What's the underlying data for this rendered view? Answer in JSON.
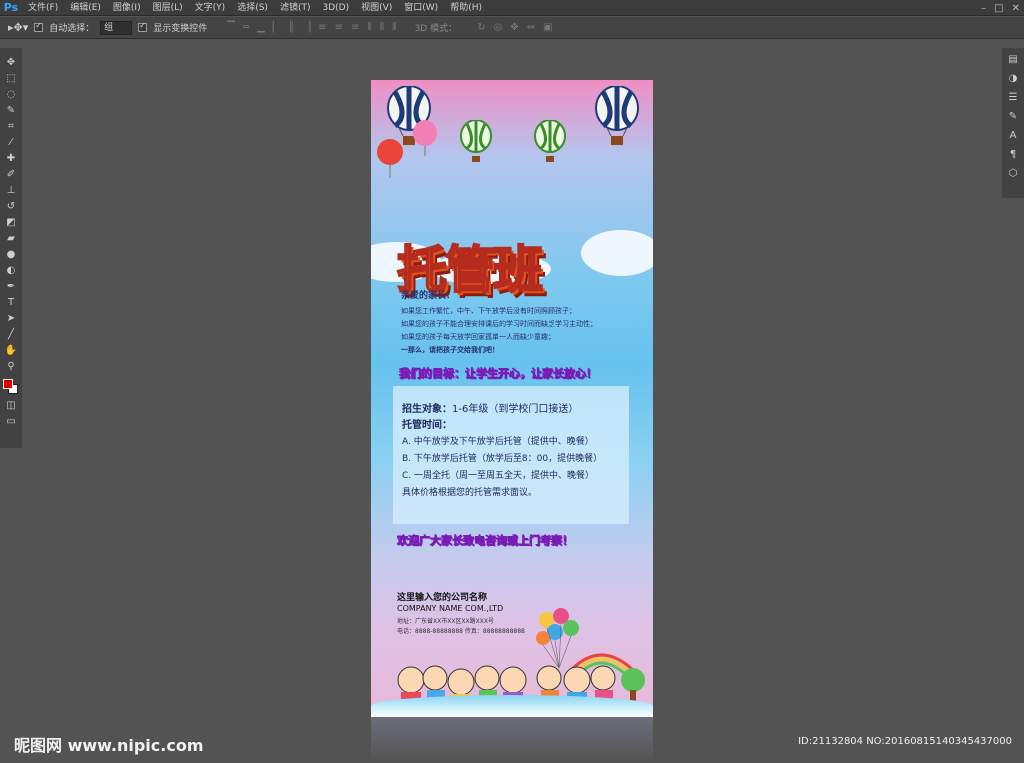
{
  "app": {
    "logo": "Ps",
    "menus": [
      "文件(F)",
      "编辑(E)",
      "图像(I)",
      "图层(L)",
      "文字(Y)",
      "选择(S)",
      "滤镜(T)",
      "3D(D)",
      "视图(V)",
      "窗口(W)",
      "帮助(H)"
    ],
    "window_controls": [
      "–",
      "□",
      "✕"
    ]
  },
  "options_bar": {
    "auto_select_label": "自动选择：",
    "auto_select_value": "组",
    "show_transform_label": "显示变换控件",
    "mode_label": "3D 模式："
  },
  "toolbar": {
    "tools": [
      "move-tool",
      "marquee-tool",
      "lasso-tool",
      "quick-select-tool",
      "crop-tool",
      "eyedropper-tool",
      "healing-tool",
      "brush-tool",
      "stamp-tool",
      "history-brush-tool",
      "eraser-tool",
      "gradient-tool",
      "blur-tool",
      "dodge-tool",
      "pen-tool",
      "type-tool",
      "path-select-tool",
      "line-tool",
      "hand-tool",
      "zoom-tool"
    ],
    "foreground_color": "#d80000",
    "background_color": "#ffffff"
  },
  "poster": {
    "title": "托管班",
    "greeting": "亲爱的家长：",
    "intro_lines": [
      "如果您工作繁忙，中午、下午放学后没有时间照顾孩子；",
      "如果您的孩子不能合理安排课后的学习时间而缺乏学习主动性；",
      "如果您的孩子每天放学回家孤单一人而缺少童趣；"
    ],
    "closing": "一那么，请把孩子交给我们吧！",
    "goal": "我们的目标：让学生开心，让家长放心！",
    "enroll_label": "招生对象：",
    "enroll_value": "1-6年级（到学校门口接送）",
    "time_title": "托管时间：",
    "options": [
      "A. 中午放学及下午放学后托管（提供中、晚餐）",
      "B. 下午放学后托管（放学后至8：00，提供晚餐）",
      "C. 一周全托（周一至周五全天，提供中、晚餐）",
      "具体价格根据您的托管需求面议。"
    ],
    "welcome": "欢迎广大家长致电咨询或上门考察！",
    "company_cn": "这里输入您的公司名称",
    "company_en": "COMPANY NAME COM.,LTD",
    "address": "地址：广东省XX市XX区XX路XXX号",
    "phone": "电话：8888-88888888  传真：88888888888"
  },
  "watermark": {
    "site": "昵图网 www.nipic.com",
    "id": "ID:21132804 NO:20160815140345437000"
  }
}
